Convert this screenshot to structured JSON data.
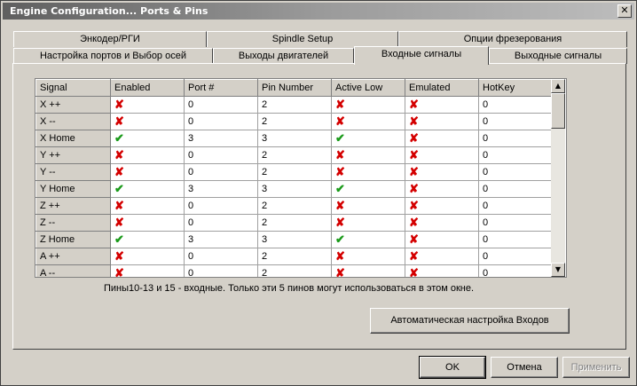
{
  "window": {
    "title": "Engine Configuration... Ports & Pins",
    "close_glyph": "✕"
  },
  "tabs_row1": [
    {
      "label": "Энкодер/РГИ"
    },
    {
      "label": "Spindle Setup"
    },
    {
      "label": "Опции фрезерования"
    }
  ],
  "tabs_row2": [
    {
      "label": "Настройка портов и Выбор осей"
    },
    {
      "label": "Выходы двигателей"
    },
    {
      "label": "Входные сигналы",
      "active": true
    },
    {
      "label": "Выходные сигналы"
    }
  ],
  "grid": {
    "headers": [
      "Signal",
      "Enabled",
      "Port #",
      "Pin Number",
      "Active Low",
      "Emulated",
      "HotKey"
    ],
    "rows": [
      {
        "signal": "X ++",
        "enabled": false,
        "port": "0",
        "pin": "2",
        "active_low": false,
        "emulated": false,
        "hotkey": "0"
      },
      {
        "signal": "X --",
        "enabled": false,
        "port": "0",
        "pin": "2",
        "active_low": false,
        "emulated": false,
        "hotkey": "0"
      },
      {
        "signal": "X Home",
        "enabled": true,
        "port": "3",
        "pin": "3",
        "active_low": true,
        "emulated": false,
        "hotkey": "0"
      },
      {
        "signal": "Y ++",
        "enabled": false,
        "port": "0",
        "pin": "2",
        "active_low": false,
        "emulated": false,
        "hotkey": "0"
      },
      {
        "signal": "Y --",
        "enabled": false,
        "port": "0",
        "pin": "2",
        "active_low": false,
        "emulated": false,
        "hotkey": "0"
      },
      {
        "signal": "Y Home",
        "enabled": true,
        "port": "3",
        "pin": "3",
        "active_low": true,
        "emulated": false,
        "hotkey": "0"
      },
      {
        "signal": "Z ++",
        "enabled": false,
        "port": "0",
        "pin": "2",
        "active_low": false,
        "emulated": false,
        "hotkey": "0"
      },
      {
        "signal": "Z --",
        "enabled": false,
        "port": "0",
        "pin": "2",
        "active_low": false,
        "emulated": false,
        "hotkey": "0"
      },
      {
        "signal": "Z Home",
        "enabled": true,
        "port": "3",
        "pin": "3",
        "active_low": true,
        "emulated": false,
        "hotkey": "0"
      },
      {
        "signal": "A ++",
        "enabled": false,
        "port": "0",
        "pin": "2",
        "active_low": false,
        "emulated": false,
        "hotkey": "0"
      },
      {
        "signal": "A --",
        "enabled": false,
        "port": "0",
        "pin": "2",
        "active_low": false,
        "emulated": false,
        "hotkey": "0"
      }
    ],
    "icons": {
      "off": "✘",
      "on": "✔"
    },
    "colors": {
      "off": "#d40000",
      "on": "#1a9a1a"
    },
    "scroll_up": "▲",
    "scroll_down": "▼"
  },
  "note": "Пины10-13 и 15 - входные. Только эти 5 пинов могут использоваться в этом окне.",
  "auto_button": "Автоматическая настройка Входов",
  "footer": {
    "ok": "OK",
    "cancel": "Отмена",
    "apply": "Применить"
  }
}
